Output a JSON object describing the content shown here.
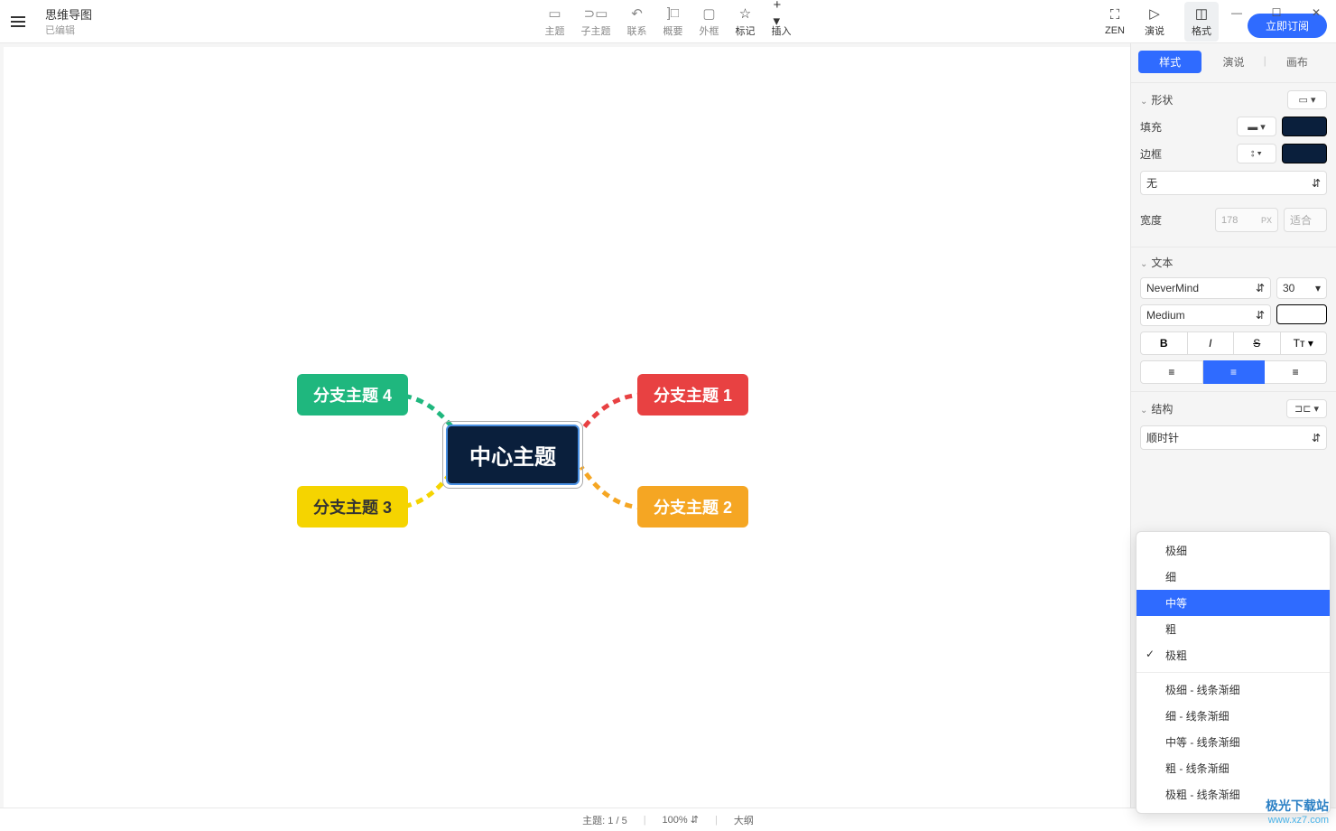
{
  "header": {
    "title": "思维导图",
    "subtitle": "已编辑"
  },
  "toolbar": {
    "topic": "主题",
    "subtopic": "子主题",
    "relation": "联系",
    "summary": "概要",
    "boundary": "外框",
    "marker": "标记",
    "insert": "插入",
    "zen": "ZEN",
    "present": "演说",
    "format": "格式",
    "subscribe": "立即订阅"
  },
  "mindmap": {
    "center": "中心主题",
    "branch1": "分支主题 1",
    "branch2": "分支主题 2",
    "branch3": "分支主题 3",
    "branch4": "分支主题 4"
  },
  "panel": {
    "tabs": {
      "style": "样式",
      "present": "演说",
      "canvas": "画布"
    },
    "shape": {
      "label": "形状"
    },
    "fill": {
      "label": "填充"
    },
    "border": {
      "label": "边框",
      "style": "无"
    },
    "width": {
      "label": "宽度",
      "value": "178",
      "unit": "PX",
      "fit": "适合"
    },
    "text": {
      "label": "文本",
      "font": "NeverMind",
      "size": "30",
      "weight": "Medium"
    },
    "structure": {
      "label": "结构",
      "direction": "顺时针"
    }
  },
  "dropdown": {
    "items": [
      "极细",
      "细",
      "中等",
      "粗",
      "极粗",
      "极细 - 线条渐细",
      "细 - 线条渐细",
      "中等 - 线条渐细",
      "粗 - 线条渐细",
      "极粗 - 线条渐细"
    ],
    "selectedIndex": 2,
    "checkedIndex": 4
  },
  "statusbar": {
    "topic_label": "主题:",
    "topic_count": "1 / 5",
    "zoom": "100%",
    "outline": "大纲"
  },
  "watermark": {
    "line1": "极光下载站",
    "line2": "www.xz7.com"
  }
}
